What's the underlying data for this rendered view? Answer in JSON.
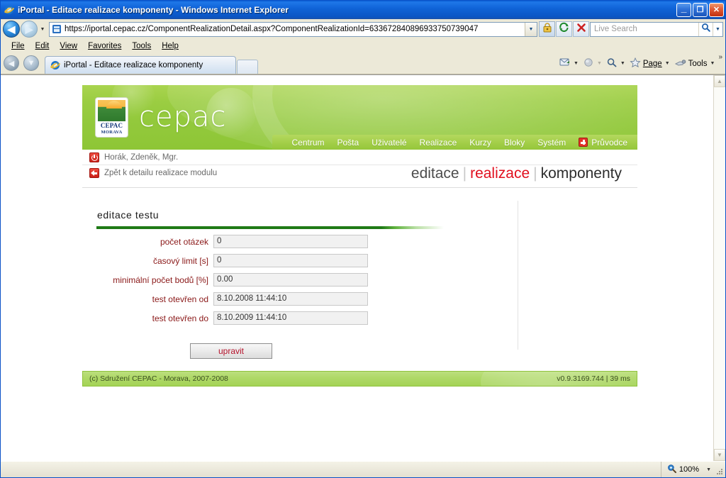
{
  "window": {
    "title": "iPortal - Editace realizace komponenty - Windows Internet Explorer",
    "minimize_label": "_",
    "maximize_label": "❐",
    "close_label": "✕"
  },
  "address_bar": {
    "back_label": "◀",
    "forward_label": "▶",
    "history_caret": "▼",
    "url": "https://iportal.cepac.cz/ComponentRealizationDetail.aspx?ComponentRealizationId=633672840896933750739047",
    "url_drop_caret": "▼",
    "lock_title": "Security Report",
    "refresh_title": "Refresh",
    "stop_title": "Stop",
    "search_placeholder": "Live Search",
    "search_drop_caret": "▼"
  },
  "menu": {
    "items": [
      "File",
      "Edit",
      "View",
      "Favorites",
      "Tools",
      "Help"
    ]
  },
  "tabs": {
    "active_label": "iPortal - Editace realizace komponenty",
    "new_tab_label": "",
    "quick_back": "◀",
    "quick_fwd": "▼",
    "right_buttons": [
      {
        "label": "",
        "caret": "▼",
        "name": "read-mail-button"
      },
      {
        "label": "",
        "caret": "▼",
        "name": "print-button"
      },
      {
        "label": "",
        "caret": "▼",
        "name": "find-button"
      },
      {
        "label": "Page",
        "caret": "▼",
        "name": "page-button"
      },
      {
        "label": "Tools",
        "caret": "▼",
        "name": "tools-button"
      }
    ],
    "overflow_label": "»"
  },
  "status_bar": {
    "left_text": "",
    "zoom_level": "100%",
    "zoom_caret": "▼"
  },
  "scrollbar": {
    "up_arrow": "▲",
    "down_arrow": "▼"
  },
  "site": {
    "logo": {
      "name": "CEPAC",
      "subtitle": "MORAVA"
    },
    "wordmark": "cepac",
    "nav": [
      {
        "label": "Centrum"
      },
      {
        "label": "Pošta"
      },
      {
        "label": "Uživatelé"
      },
      {
        "label": "Realizace"
      },
      {
        "label": "Kurzy"
      },
      {
        "label": "Bloky"
      },
      {
        "label": "Systém"
      },
      {
        "label": "Průvodce",
        "icon": "plus-icon"
      }
    ],
    "user_row": "Horák, Zdeněk, Mgr.",
    "back_link": "Zpět k detailu realizace modulu",
    "page_title": {
      "part1": "editace",
      "separator": "|",
      "part2": "realizace",
      "part3": "komponenty"
    },
    "panel": {
      "heading": "editace testu",
      "fields": [
        {
          "label": "počet otázek",
          "value": "0"
        },
        {
          "label": "časový limit [s]",
          "value": "0"
        },
        {
          "label": "minimální počet bodů [%]",
          "value": "0.00"
        },
        {
          "label": "test otevřen od",
          "value": "8.10.2008 11:44:10"
        },
        {
          "label": "test otevřen do",
          "value": "8.10.2009 11:44:10"
        }
      ],
      "submit_label": "upravit"
    },
    "footer": {
      "copyright": "(c) Sdružení CEPAC - Morava, 2007-2008",
      "version": "v0.9.3169.744 | 39 ms"
    }
  },
  "colors": {
    "brand_green": "#9bcd42",
    "nav_green": "#a6d04c",
    "accent_red": "#e10f1e",
    "label_maroon": "#8a1818",
    "rule_green": "#1f7a16",
    "titlebar_blue": "#1064d8"
  }
}
